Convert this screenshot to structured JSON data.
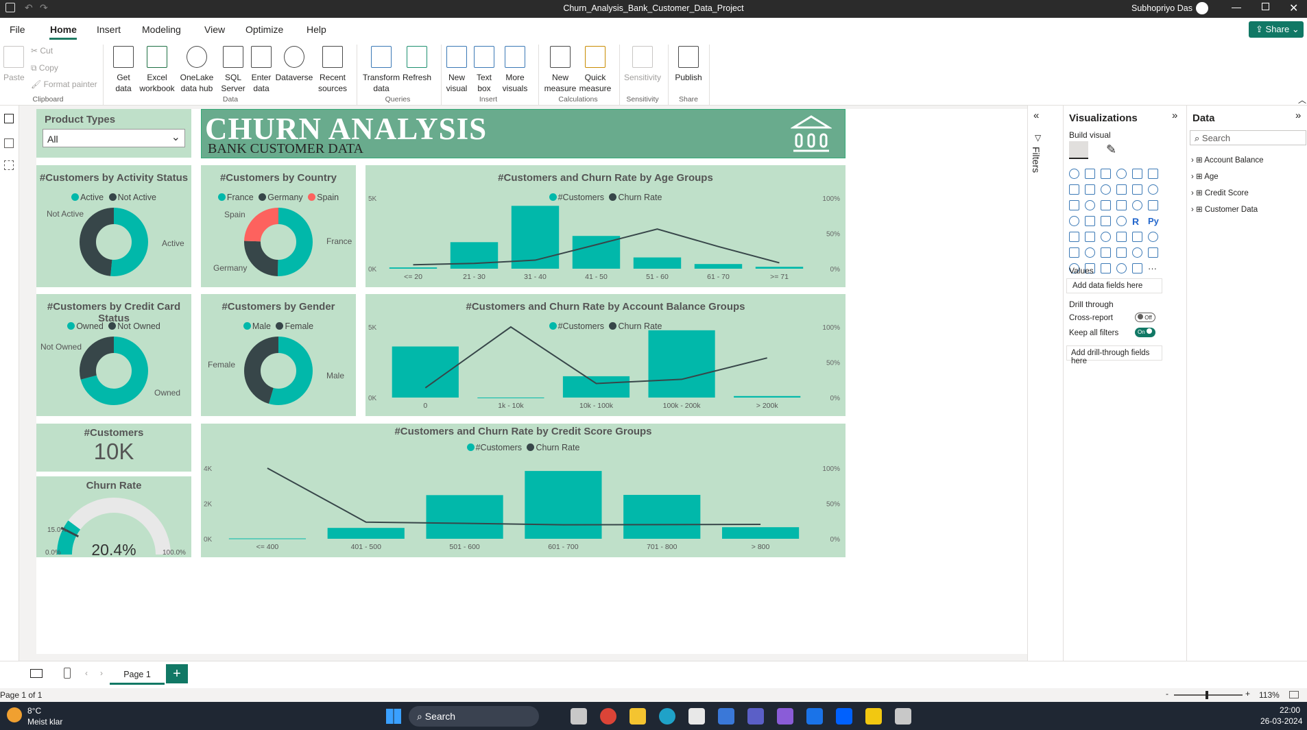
{
  "window": {
    "title": "Churn_Analysis_Bank_Customer_Data_Project",
    "user": "Subhopriyo Das"
  },
  "menu": [
    "File",
    "Home",
    "Insert",
    "Modeling",
    "View",
    "Optimize",
    "Help"
  ],
  "share_label": "Share",
  "ribbon": {
    "clipboard": {
      "paste": "Paste",
      "cut": "Cut",
      "copy": "Copy",
      "format_painter": "Format painter",
      "group": "Clipboard"
    },
    "data": {
      "get_data": "Get data",
      "excel": "Excel workbook",
      "onelake": "OneLake data hub",
      "sql": "SQL Server",
      "enter": "Enter data",
      "dataverse": "Dataverse",
      "recent": "Recent sources",
      "group": "Data"
    },
    "queries": {
      "transform": "Transform data",
      "refresh": "Refresh",
      "group": "Queries"
    },
    "insert": {
      "new_visual": "New visual",
      "text_box": "Text box",
      "more_visuals": "More visuals",
      "group": "Insert"
    },
    "calculations": {
      "new_measure": "New measure",
      "quick_measure": "Quick measure",
      "group": "Calculations"
    },
    "sensitivity": {
      "label": "Sensitivity",
      "group": "Sensitivity"
    },
    "share": {
      "publish": "Publish",
      "group": "Share"
    }
  },
  "slicer": {
    "title": "Product Types",
    "value": "All"
  },
  "banner": {
    "title": "CHURN ANALYSIS",
    "subtitle": "BANK CUSTOMER DATA"
  },
  "colors": {
    "teal": "#01b8aa",
    "dark": "#374649",
    "red": "#fd625e",
    "card": "#bfe0c9",
    "banner": "#69ab8d"
  },
  "activity": {
    "title": "#Customers by Activity Status",
    "legend": [
      "Active",
      "Not Active"
    ],
    "labels": [
      "Not Active",
      "Active"
    ],
    "values": [
      51.5,
      48.5
    ]
  },
  "country": {
    "title": "#Customers by Country",
    "legend": [
      "France",
      "Germany",
      "Spain"
    ],
    "labels": [
      "Spain",
      "France",
      "Germany"
    ],
    "values": [
      50.1,
      25.1,
      24.8
    ]
  },
  "creditcard": {
    "title": "#Customers by Credit Card Status",
    "legend": [
      "Owned",
      "Not Owned"
    ],
    "labels": [
      "Not Owned",
      "Owned"
    ],
    "values": [
      70.6,
      29.4
    ]
  },
  "gender": {
    "title": "#Customers by Gender",
    "legend": [
      "Male",
      "Female"
    ],
    "labels": [
      "Female",
      "Male"
    ],
    "values": [
      54.6,
      45.4
    ]
  },
  "kpi_customers": {
    "title": "#Customers",
    "value": "10K"
  },
  "kpi_churn": {
    "title": "Churn Rate",
    "value": "20.4%",
    "min": "0.0%",
    "max": "100.0%",
    "target": "15.0%",
    "fraction": 0.204,
    "target_fraction": 0.15
  },
  "age_chart": {
    "title": "#Customers and Churn Rate by Age Groups",
    "legend": [
      "#Customers",
      "Churn Rate"
    ]
  },
  "balance_chart": {
    "title": "#Customers and Churn Rate by Account Balance Groups",
    "legend": [
      "#Customers",
      "Churn Rate"
    ]
  },
  "credit_chart": {
    "title": "#Customers and Churn Rate by Credit Score Groups",
    "legend": [
      "#Customers",
      "Churn Rate"
    ]
  },
  "chart_data": [
    {
      "type": "bar",
      "title": "#Customers and Churn Rate by Age Groups",
      "categories": [
        "<= 20",
        "21 - 30",
        "31 - 40",
        "41 - 50",
        "51 - 60",
        "61 - 70",
        ">= 71"
      ],
      "series": [
        {
          "name": "#Customers",
          "values": [
            89,
            1879,
            4451,
            2320,
            797,
            331,
            133
          ]
        },
        {
          "name": "Churn Rate",
          "values": [
            5.6,
            7.5,
            12.1,
            34.0,
            56.2,
            31.4,
            8.3
          ]
        }
      ],
      "y_ticks": [
        "0K",
        "5K"
      ],
      "y2_ticks": [
        "0%",
        "50%",
        "100%"
      ],
      "ylim": [
        0,
        5000
      ],
      "y2lim": [
        0,
        100
      ]
    },
    {
      "type": "bar",
      "title": "#Customers and Churn Rate by Account Balance Groups",
      "categories": [
        "0",
        "1k - 10k",
        "10k - 100k",
        "100k - 200k",
        "> 200k"
      ],
      "series": [
        {
          "name": "#Customers",
          "values": [
            3617,
            2,
            1509,
            4765,
            107
          ]
        },
        {
          "name": "Churn Rate",
          "values": [
            13.8,
            100,
            19.9,
            25.8,
            56.1
          ]
        }
      ],
      "y_ticks": [
        "0K",
        "5K"
      ],
      "y2_ticks": [
        "0%",
        "50%",
        "100%"
      ],
      "ylim": [
        0,
        5000
      ],
      "y2lim": [
        0,
        100
      ]
    },
    {
      "type": "bar",
      "title": "#Customers and Churn Rate by Credit Score Groups",
      "categories": [
        "<= 400",
        "401 - 500",
        "501 - 600",
        "601 - 700",
        "701 - 800",
        "> 800"
      ],
      "series": [
        {
          "name": "#Customers",
          "values": [
            19,
            615,
            2473,
            3841,
            2486,
            655
          ]
        },
        {
          "name": "Churn Rate",
          "values": [
            100,
            23.6,
            21.8,
            19.8,
            20.0,
            20.4
          ]
        }
      ],
      "y_ticks": [
        "0K",
        "2K",
        "4K"
      ],
      "y2_ticks": [
        "0%",
        "50%",
        "100%"
      ],
      "ylim": [
        0,
        4000
      ],
      "y2lim": [
        0,
        100
      ]
    }
  ],
  "filters_label": "Filters",
  "viz": {
    "title": "Visualizations",
    "build": "Build visual",
    "values": "Values",
    "add_fields": "Add data fields here",
    "drill": "Drill through",
    "cross": "Cross-report",
    "cross_state": "Off",
    "keep": "Keep all filters",
    "keep_state": "On",
    "add_drill": "Add drill-through fields here",
    "r": "R",
    "py": "Py"
  },
  "data_pane": {
    "title": "Data",
    "search": "Search",
    "tables": [
      "Account Balance",
      "Age",
      "Credit Score",
      "Customer Data"
    ]
  },
  "pages": {
    "current": "Page 1",
    "status": "Page 1 of 1",
    "zoom": "113%"
  },
  "taskbar": {
    "temp": "8°C",
    "weather": "Meist klar",
    "search": "Search",
    "time": "22:00",
    "date": "26-03-2024"
  }
}
